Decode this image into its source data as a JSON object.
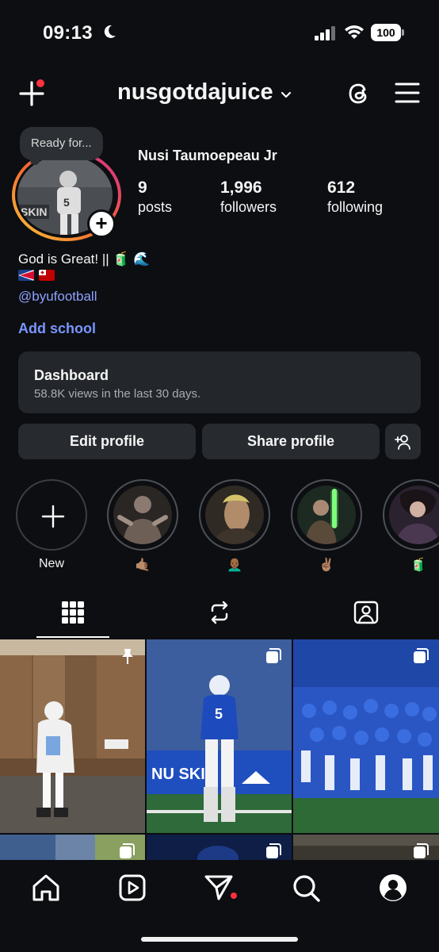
{
  "status_bar": {
    "time": "09:13",
    "battery": "100"
  },
  "header": {
    "username": "nusgotdajuice"
  },
  "profile": {
    "note": "Ready for...",
    "full_name": "Nusi Taumoepeau Jr",
    "stats": [
      {
        "value": "9",
        "label": "posts"
      },
      {
        "value": "1,996",
        "label": "followers"
      },
      {
        "value": "612",
        "label": "following"
      }
    ],
    "bio": "God is Great! || 🧃 🌊",
    "link": "@byufootball",
    "add_school": "Add school"
  },
  "dashboard": {
    "title": "Dashboard",
    "subtitle": "58.8K views in the last 30 days."
  },
  "buttons": {
    "edit": "Edit profile",
    "share": "Share profile"
  },
  "highlights": [
    {
      "label": "New"
    },
    {
      "label": "🤙🏽"
    },
    {
      "label": "👨🏾‍🦲"
    },
    {
      "label": "✌🏽"
    },
    {
      "label": "🧃"
    }
  ],
  "colors": {
    "accent_link": "#7b95ff",
    "background": "#0c0e11",
    "notification": "#ff3040"
  }
}
